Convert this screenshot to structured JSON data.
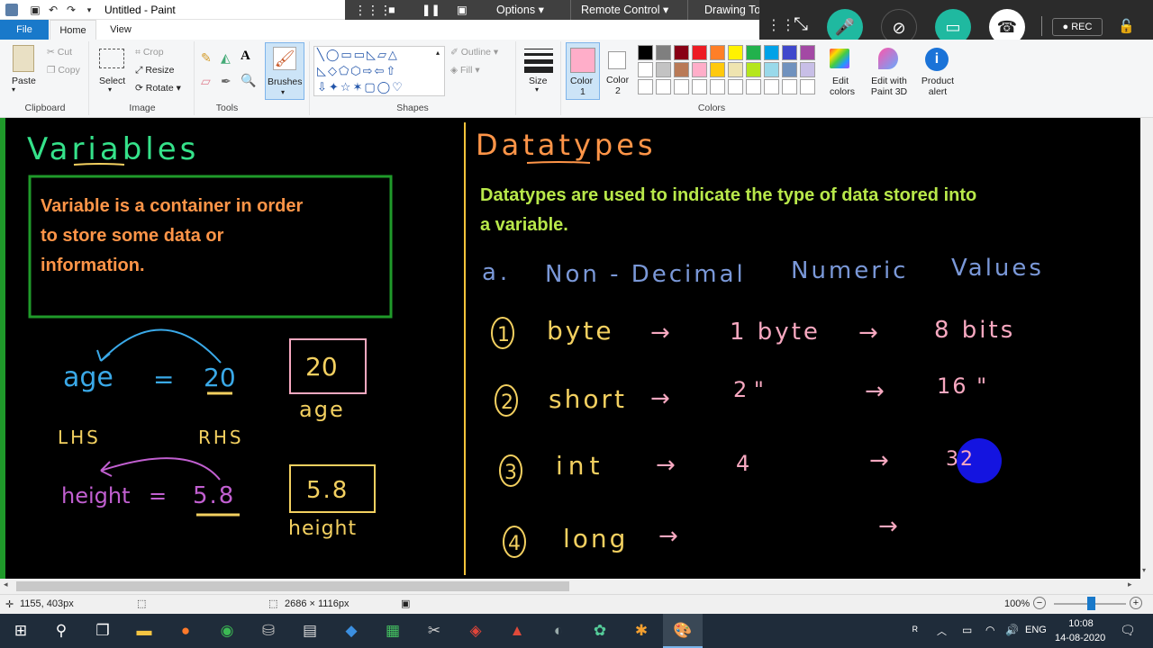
{
  "window": {
    "title": "Untitled - Paint"
  },
  "remote_bar": {
    "options": "Options",
    "remote_control": "Remote Control",
    "drawing_tools": "Drawing To"
  },
  "meeting": {
    "rec": "REC"
  },
  "ribbon_tabs": {
    "file": "File",
    "home": "Home",
    "view": "View"
  },
  "clipboard": {
    "paste": "Paste",
    "cut": "Cut",
    "copy": "Copy",
    "group": "Clipboard"
  },
  "image": {
    "select": "Select",
    "crop": "Crop",
    "resize": "Resize",
    "rotate": "Rotate",
    "group": "Image"
  },
  "tools": {
    "group": "Tools"
  },
  "brushes": {
    "label": "Brushes"
  },
  "shapes": {
    "outline": "Outline",
    "fill": "Fill",
    "group": "Shapes"
  },
  "size": {
    "label": "Size"
  },
  "colors": {
    "color1_label": "Color",
    "color1_num": "1",
    "color2_label": "Color",
    "color2_num": "2",
    "group": "Colors",
    "edit_colors": "Edit colors",
    "paint3d": "Edit with Paint 3D",
    "product_alert": "Product alert"
  },
  "palette": [
    "#000000",
    "#7f7f7f",
    "#880015",
    "#ed1c24",
    "#ff7f27",
    "#fff200",
    "#22b14c",
    "#00a2e8",
    "#3f48cc",
    "#a349a4",
    "#ffffff",
    "#c3c3c3",
    "#b97a57",
    "#ffaec9",
    "#ffc90e",
    "#efe4b0",
    "#b5e61d",
    "#99d9ea",
    "#7092be",
    "#c8bfe7"
  ],
  "canvas": {
    "variables_title": "Variables",
    "variables_def_line1": "Variable is a container in order",
    "variables_def_line2": "to store some data or",
    "variables_def_line3": "information.",
    "age_lhs": "age",
    "equals1": "=",
    "age_val": "20",
    "box1_val": "20",
    "box1_label": "age",
    "lhs": "LHS",
    "rhs": "RHS",
    "height_lhs": "height",
    "equals2": "=",
    "height_val": "5.8",
    "box2_val": "5.8",
    "box2_label": "height",
    "datatypes_title": "Datatypes",
    "datatypes_def_line1": "Datatypes are used to indicate the type of data stored into",
    "datatypes_def_line2": "a variable.",
    "section_a": "a.",
    "section_words": [
      "Non - Decimal",
      "Numeric",
      "Values"
    ],
    "rows": [
      {
        "num": "1",
        "type": "byte",
        "size": "1  byte",
        "bits": "8  bits"
      },
      {
        "num": "2",
        "type": "short",
        "size": "2     \"",
        "bits": "16  \""
      },
      {
        "num": "3",
        "type": "int",
        "size": "4",
        "bits": "32"
      },
      {
        "num": "4",
        "type": "long",
        "size": "",
        "bits": ""
      }
    ]
  },
  "statusbar": {
    "position": "1155, 403px",
    "dimensions": "2686 × 1116px",
    "zoom": "100%"
  },
  "taskbar": {
    "lang": "ENG",
    "time": "10:08",
    "date": "14-08-2020"
  }
}
